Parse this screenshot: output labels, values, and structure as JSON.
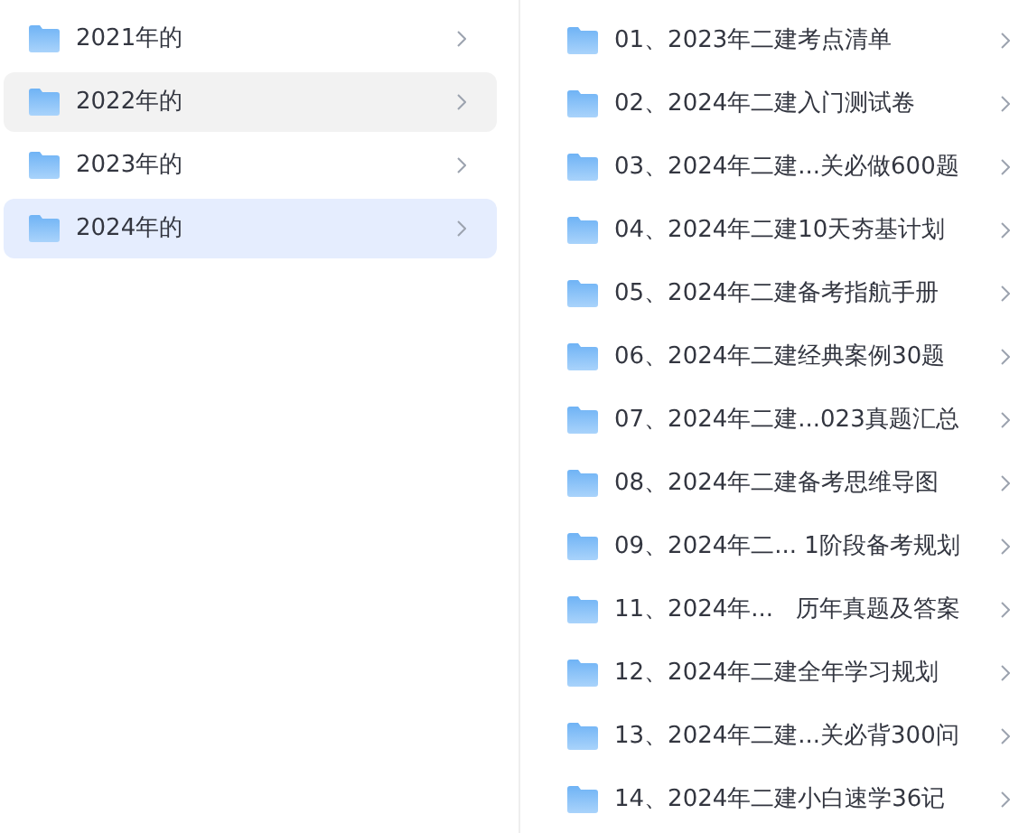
{
  "years": [
    {
      "label": "2021年的",
      "selected": false,
      "hovered": false
    },
    {
      "label": "2022年的",
      "selected": false,
      "hovered": true
    },
    {
      "label": "2023年的",
      "selected": false,
      "hovered": false
    },
    {
      "label": "2024年的",
      "selected": true,
      "hovered": false
    }
  ],
  "files": [
    {
      "label": "01、2023年二建考点清单"
    },
    {
      "label": "02、2024年二建入门测试卷"
    },
    {
      "label": "03、2024年二建...关必做600题"
    },
    {
      "label": "04、2024年二建10天夯基计划"
    },
    {
      "label": "05、2024年二建备考指航手册"
    },
    {
      "label": "06、2024年二建经典案例30题"
    },
    {
      "label": "07、2024年二建...023真题汇总"
    },
    {
      "label": "08、2024年二建备考思维导图"
    },
    {
      "label": "09、2024年二... 1阶段备考规划"
    },
    {
      "label": "11、2024年...   历年真题及答案"
    },
    {
      "label": "12、2024年二建全年学习规划"
    },
    {
      "label": "13、2024年二建...关必背300问"
    },
    {
      "label": "14、2024年二建小白速学36记"
    }
  ]
}
